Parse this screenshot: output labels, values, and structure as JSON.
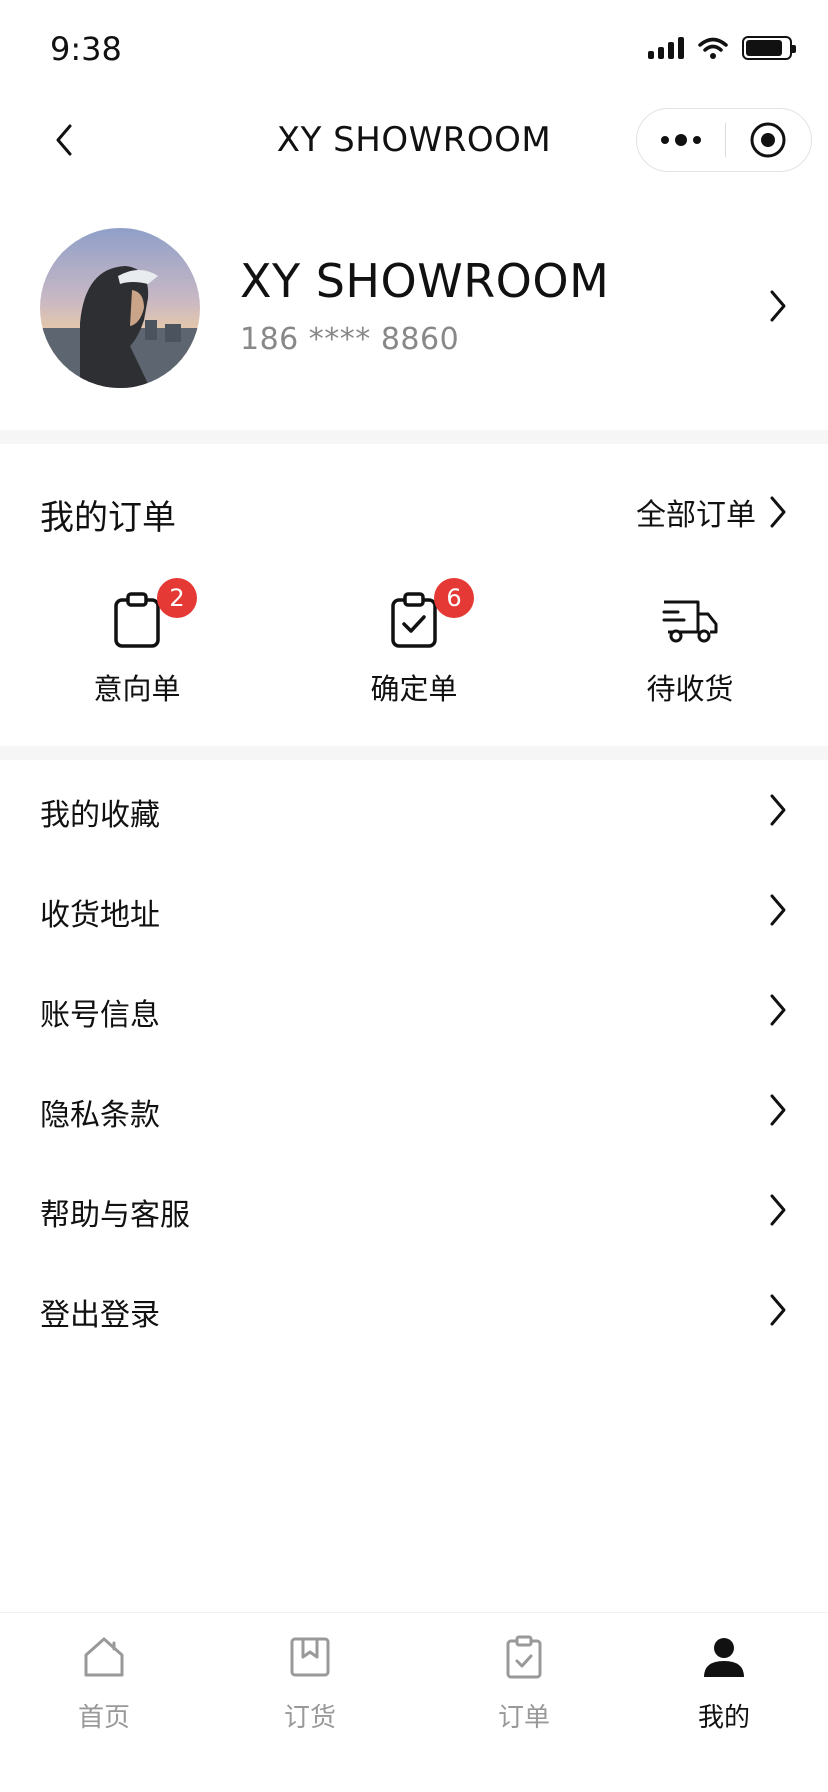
{
  "status_bar": {
    "time": "9:38"
  },
  "nav": {
    "title": "XY SHOWROOM"
  },
  "profile": {
    "name": "XY SHOWROOM",
    "phone": "186 **** 8860"
  },
  "orders": {
    "title": "我的订单",
    "all_label": "全部订单",
    "items": [
      {
        "label": "意向单",
        "badge": "2",
        "icon": "clipboard-icon"
      },
      {
        "label": "确定单",
        "badge": "6",
        "icon": "clipboard-check-icon"
      },
      {
        "label": "待收货",
        "icon": "truck-icon"
      }
    ]
  },
  "menu": {
    "items": [
      {
        "label": "我的收藏"
      },
      {
        "label": "收货地址"
      },
      {
        "label": "账号信息"
      },
      {
        "label": "隐私条款"
      },
      {
        "label": "帮助与客服"
      },
      {
        "label": "登出登录"
      }
    ]
  },
  "tabs": [
    {
      "label": "首页",
      "icon": "home-icon"
    },
    {
      "label": "订货",
      "icon": "bookmark-icon"
    },
    {
      "label": "订单",
      "icon": "clipboard-check-icon"
    },
    {
      "label": "我的",
      "icon": "user-icon",
      "active": true
    }
  ],
  "colors": {
    "badge": "#e53935",
    "text": "#111111",
    "muted": "#999999",
    "divider": "#f6f6f6"
  }
}
